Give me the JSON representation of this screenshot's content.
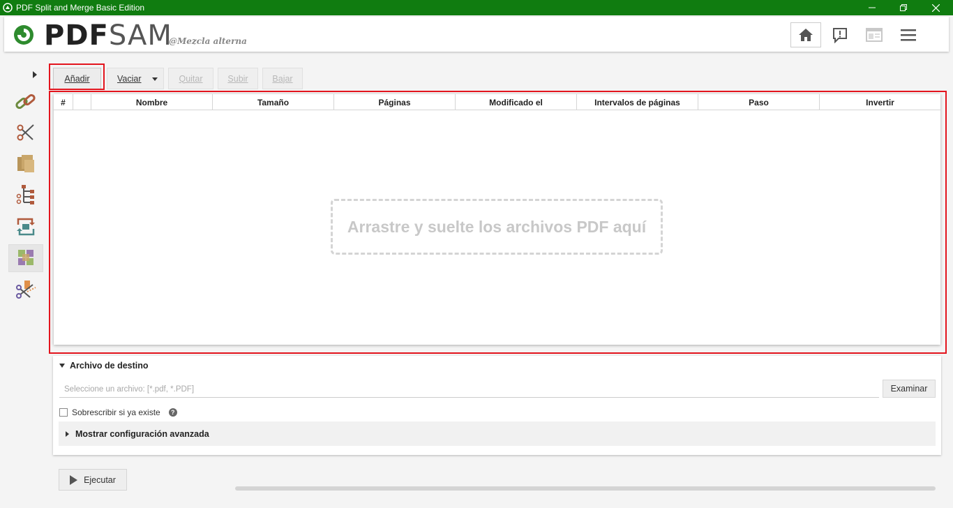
{
  "window": {
    "title": "PDF Split and Merge Basic Edition"
  },
  "header": {
    "logo_prefix": "PDF",
    "logo_suffix": "SAM",
    "module_name": "@Mezcla alterna"
  },
  "toolbar": {
    "add_label": "Añadir",
    "clear_label": "Vaciar",
    "remove_label": "Quitar",
    "up_label": "Subir",
    "down_label": "Bajar"
  },
  "table": {
    "columns": [
      "#",
      "",
      "Nombre",
      "Tamaño",
      "Páginas",
      "Modificado el",
      "Intervalos de páginas",
      "Paso",
      "Invertir"
    ],
    "drop_hint": "Arrastre y suelte los archivos PDF aquí"
  },
  "destination": {
    "title": "Archivo de destino",
    "placeholder": "Seleccione un archivo: [*.pdf, *.PDF]",
    "browse_label": "Examinar",
    "overwrite_label": "Sobrescribir si ya existe",
    "overwrite_checked": false,
    "advanced_label": "Mostrar configuración avanzada"
  },
  "run": {
    "label": "Ejecutar"
  },
  "progress": {
    "fraction": 0
  },
  "sidebar": {
    "items": [
      "merge-icon",
      "split-icon",
      "split-by-size-icon",
      "split-by-bookmarks-icon",
      "rotate-icon",
      "alternate-mix-icon",
      "extract-icon"
    ],
    "active": "alternate-mix-icon"
  },
  "colors": {
    "titlebar": "#107c10",
    "highlight": "#e3141d",
    "logo_green": "#2e8b2e"
  }
}
